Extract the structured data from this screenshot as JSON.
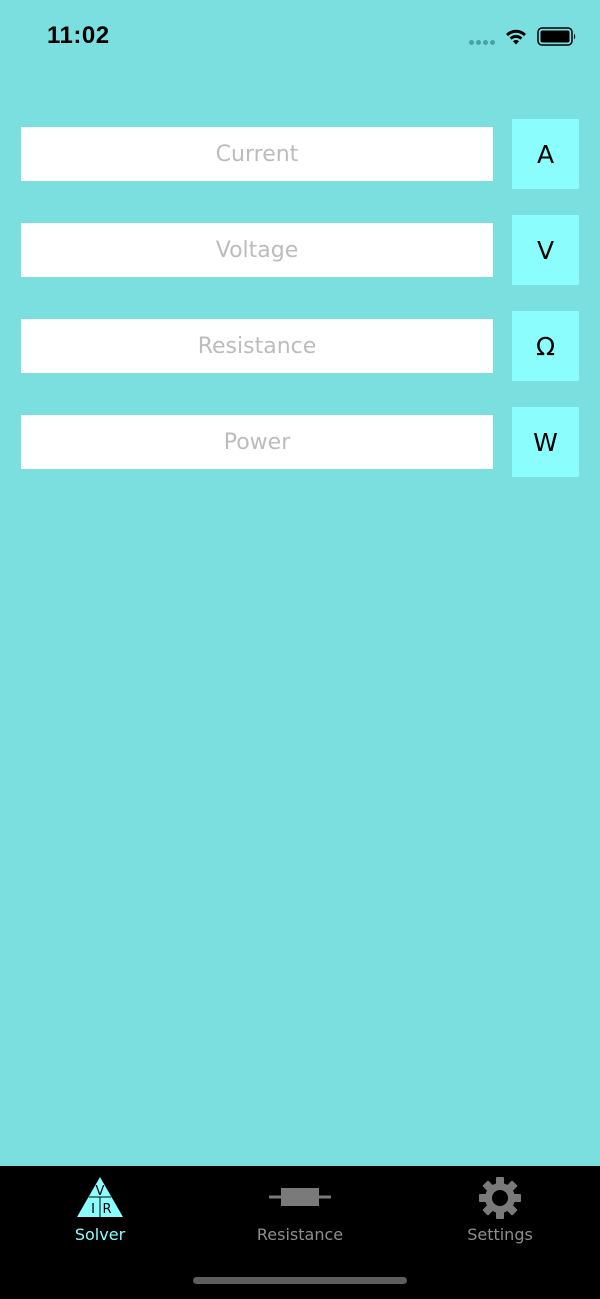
{
  "status_bar": {
    "time": "11:02",
    "icons": [
      "signal-dots-icon",
      "wifi-icon",
      "battery-icon"
    ]
  },
  "solver": {
    "rows": [
      {
        "placeholder": "Current",
        "unit": "A"
      },
      {
        "placeholder": "Voltage",
        "unit": "V"
      },
      {
        "placeholder": "Resistance",
        "unit": "Ω"
      },
      {
        "placeholder": "Power",
        "unit": "W"
      }
    ]
  },
  "tab_bar": {
    "tabs": [
      {
        "label": "Solver",
        "icon": "vir-triangle-icon",
        "active": true
      },
      {
        "label": "Resistance",
        "icon": "resistor-icon",
        "active": false
      },
      {
        "label": "Settings",
        "icon": "gear-icon",
        "active": false
      }
    ],
    "icon_triangle_letters": {
      "top": "V",
      "left": "I",
      "right": "R"
    }
  },
  "colors": {
    "background": "#7cdfdf",
    "unit_button": "#8bfdfd",
    "field": "#ffffff",
    "tab_bar": "#000000",
    "tab_active": "#8bfdfd",
    "tab_inactive": "#8e8e8e"
  }
}
